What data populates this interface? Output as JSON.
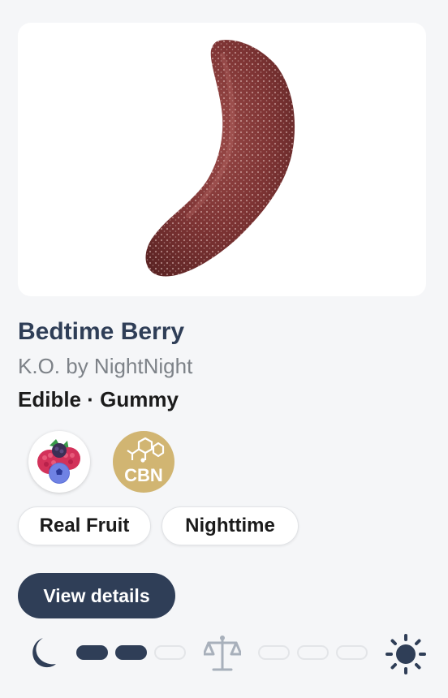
{
  "product": {
    "name": "Bedtime Berry",
    "brand": "K.O. by NightNight",
    "category": "Edible · Gummy"
  },
  "badges": {
    "fruit": {
      "icon": "berries-icon"
    },
    "cbn": {
      "icon": "cbn-molecule-icon",
      "label": "CBN"
    }
  },
  "tags": [
    "Real Fruit",
    "Nighttime"
  ],
  "actions": {
    "view_details": "View details"
  },
  "effect_scale": {
    "left_icon": "moon-icon",
    "center_icon": "balance-scale-icon",
    "right_icon": "sun-icon",
    "sleep_level": 2,
    "sleep_max": 3,
    "energy_level": 0,
    "energy_max": 3
  },
  "colors": {
    "primary": "#2f3e57",
    "muted_text": "#7d8288",
    "cbn_gold": "#d1b572",
    "gummy": "#8a3a3a"
  }
}
